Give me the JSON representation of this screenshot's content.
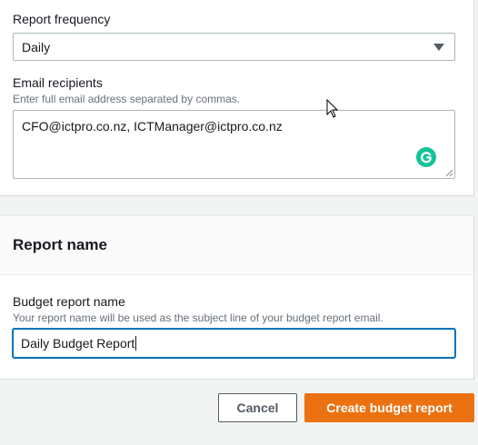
{
  "frequency": {
    "label": "Report frequency",
    "value": "Daily"
  },
  "recipients": {
    "label": "Email recipients",
    "hint": "Enter full email address separated by commas.",
    "value": "CFO@ictpro.co.nz, ICTManager@ictpro.co.nz"
  },
  "report_section": {
    "title": "Report name",
    "name_label": "Budget report name",
    "name_hint": "Your report name will be used as the subject line of your budget report email.",
    "name_value": "Daily Budget Report"
  },
  "footer": {
    "cancel_label": "Cancel",
    "create_label": "Create budget report"
  },
  "colors": {
    "primary_button": "#ec7211",
    "focus_border": "#0073bb",
    "grammarly": "#15c39a"
  },
  "icons": [
    "dropdown-caret-icon",
    "grammarly-icon",
    "resize-grip-icon",
    "mouse-cursor-icon"
  ]
}
